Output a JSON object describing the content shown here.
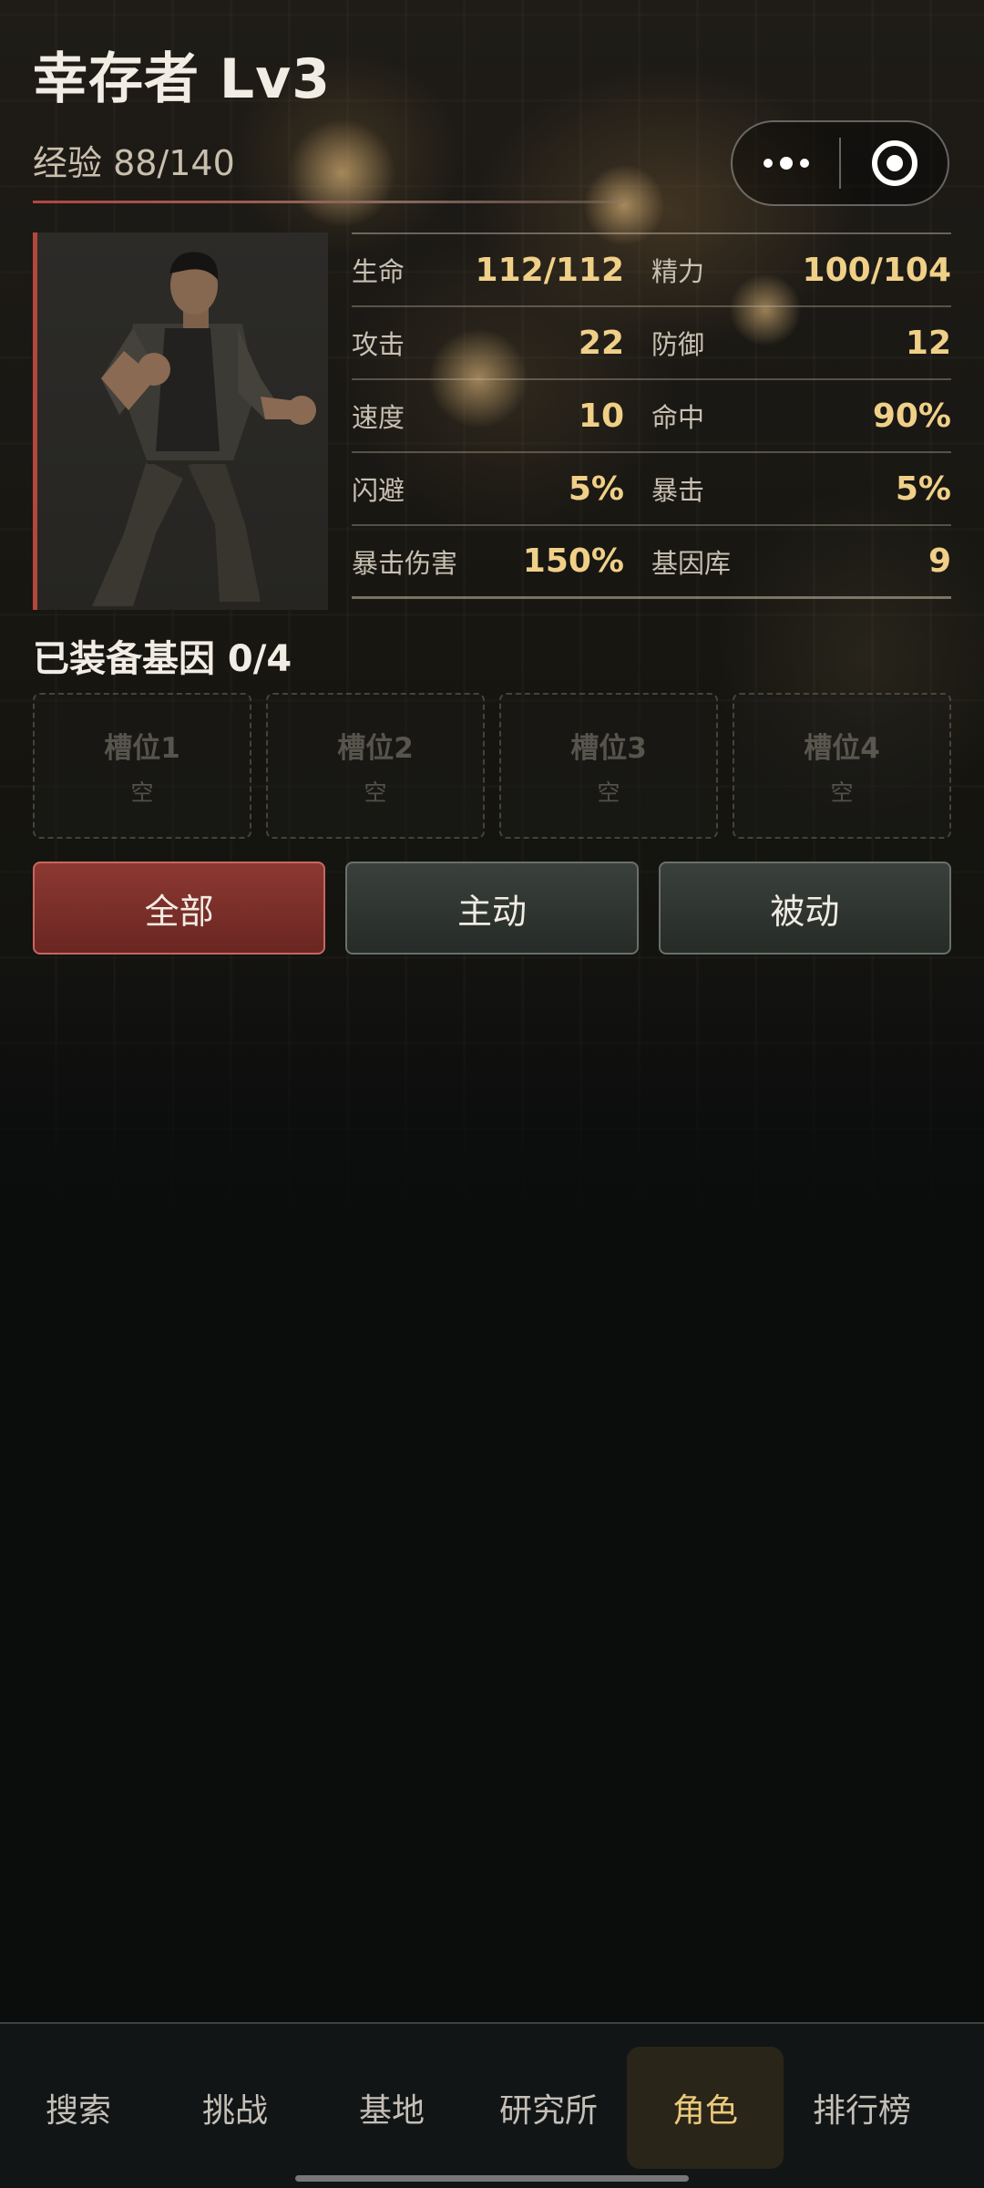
{
  "header": {
    "title": "幸存者 Lv3",
    "exp": "经验 88/140"
  },
  "stats": [
    [
      {
        "label": "生命",
        "value": "112/112"
      },
      {
        "label": "精力",
        "value": "100/104"
      }
    ],
    [
      {
        "label": "攻击",
        "value": "22"
      },
      {
        "label": "防御",
        "value": "12"
      }
    ],
    [
      {
        "label": "速度",
        "value": "10"
      },
      {
        "label": "命中",
        "value": "90%"
      }
    ],
    [
      {
        "label": "闪避",
        "value": "5%"
      },
      {
        "label": "暴击",
        "value": "5%"
      }
    ],
    [
      {
        "label": "暴击伤害",
        "value": "150%"
      },
      {
        "label": "基因库",
        "value": "9"
      }
    ]
  ],
  "genes": {
    "title": "已装备基因 0/4",
    "slots": [
      {
        "name": "槽位1",
        "value": "空"
      },
      {
        "name": "槽位2",
        "value": "空"
      },
      {
        "name": "槽位3",
        "value": "空"
      },
      {
        "name": "槽位4",
        "value": "空"
      }
    ]
  },
  "filters": {
    "all": "全部",
    "active": "主动",
    "passive": "被动",
    "selected": "all"
  },
  "nav": {
    "items": [
      "搜索",
      "挑战",
      "基地",
      "研究所",
      "角色",
      "排行榜"
    ],
    "selected": "角色"
  },
  "colors": {
    "accent_red": "#b3473e",
    "stat_value": "#f0d088",
    "nav_active": "#ecc97a"
  },
  "icons": {
    "menu": "more-dots-icon",
    "close": "target-ring-icon",
    "portrait": "fighter-portrait"
  }
}
